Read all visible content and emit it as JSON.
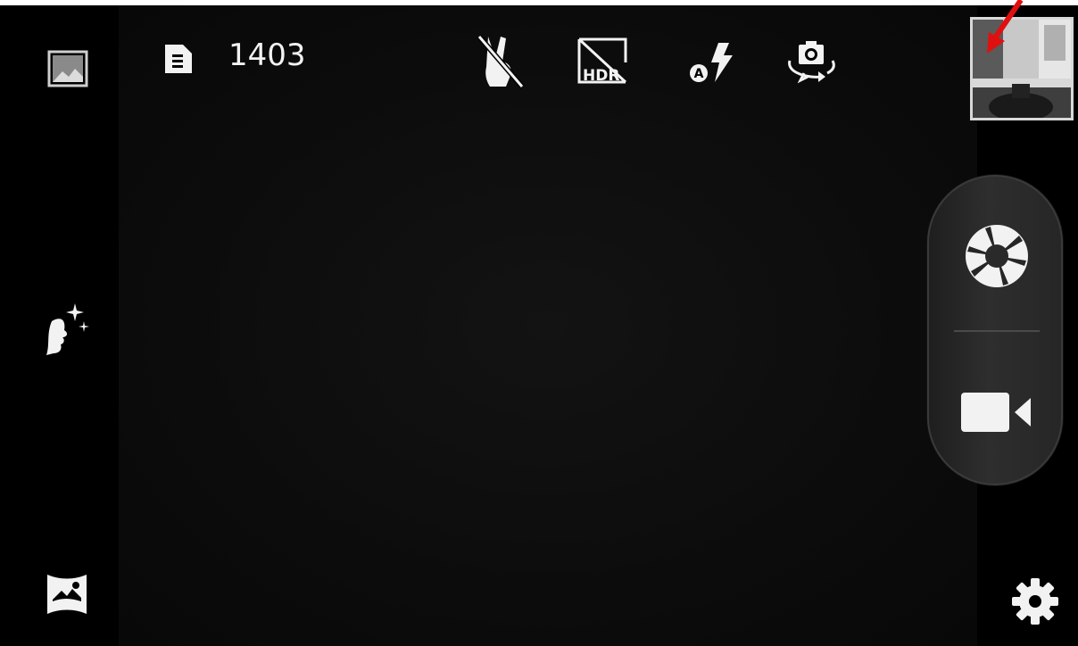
{
  "top_bar": {
    "remaining_shots": "1403",
    "icons": [
      "storage-card-icon",
      "gesture-off-icon",
      "hdr-off-icon",
      "flash-auto-icon",
      "switch-camera-icon"
    ],
    "hdr_label": "HDR",
    "flash_mode_label": "A"
  },
  "left_bar": {
    "icons": [
      "gallery-icon",
      "beauty-mode-icon",
      "panorama-icon"
    ]
  },
  "right_bar": {
    "icons": [
      "last-photo-thumbnail",
      "photo-shutter-icon",
      "video-record-icon",
      "settings-gear-icon"
    ]
  },
  "colors": {
    "background": "#000000",
    "icon": "#f2f2f2",
    "annotation_arrow": "#e01010"
  }
}
